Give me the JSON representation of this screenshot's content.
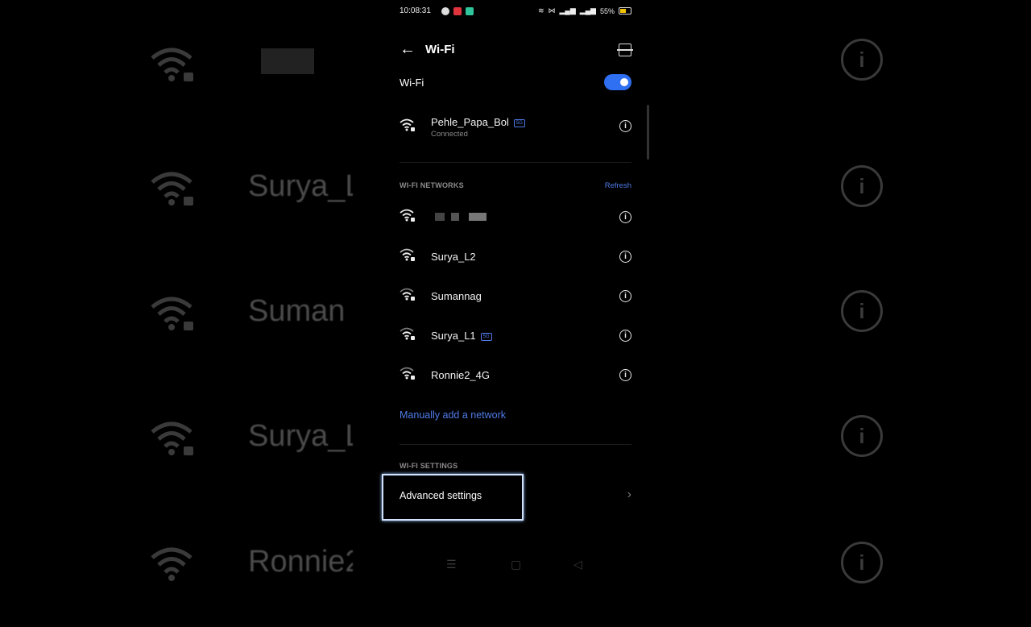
{
  "status_bar": {
    "time": "10:08:31",
    "battery": "55%"
  },
  "header": {
    "title": "Wi-Fi"
  },
  "wifi_toggle": {
    "label": "Wi-Fi"
  },
  "connected": {
    "name": "Pehle_Papa_Bol",
    "badge": "5G",
    "status": "Connected"
  },
  "networks_section": {
    "label": "WI-FI NETWORKS",
    "refresh": "Refresh"
  },
  "networks": [
    {
      "name": ""
    },
    {
      "name": "Surya_L2"
    },
    {
      "name": "Sumannag"
    },
    {
      "name": "Surya_L1",
      "badge": "5G"
    },
    {
      "name": "Ronnie2_4G"
    }
  ],
  "manual_add": "Manually add a network",
  "settings_section": {
    "label": "WI-FI SETTINGS"
  },
  "advanced": {
    "label": "Advanced settings"
  },
  "background_echo": [
    "Surya_L",
    "Suman",
    "Surya_L",
    "Ronnie2"
  ],
  "colors": {
    "accent": "#4f7be8",
    "toggle": "#2f6ff2",
    "highlight": "#cfe3ff"
  }
}
